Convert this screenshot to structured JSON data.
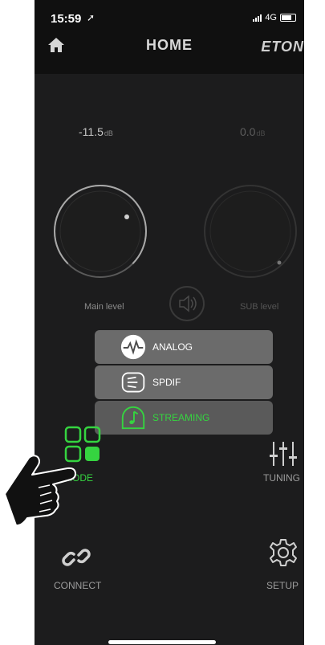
{
  "status": {
    "time": "15:59",
    "network": "4G"
  },
  "header": {
    "title": "HOME",
    "logo": "ETON"
  },
  "levels": {
    "main": {
      "value": "-11.5",
      "unit": "dB",
      "label": "Main level"
    },
    "sub": {
      "value": "0.0",
      "unit": "dB",
      "label": "SUB level"
    }
  },
  "input_menu": [
    {
      "label": "ANALOG",
      "icon": "waveform-icon",
      "active": false
    },
    {
      "label": "SPDIF",
      "icon": "optical-icon",
      "active": false
    },
    {
      "label": "STREAMING",
      "icon": "bluetooth-note-icon",
      "active": true
    }
  ],
  "nav": {
    "mode": "MODE",
    "tuning": "TUNING",
    "connect": "CONNECT",
    "setup": "SETUP"
  },
  "colors": {
    "accent": "#35d440",
    "background": "#1c1c1d",
    "menu": "#6b6b6b"
  }
}
